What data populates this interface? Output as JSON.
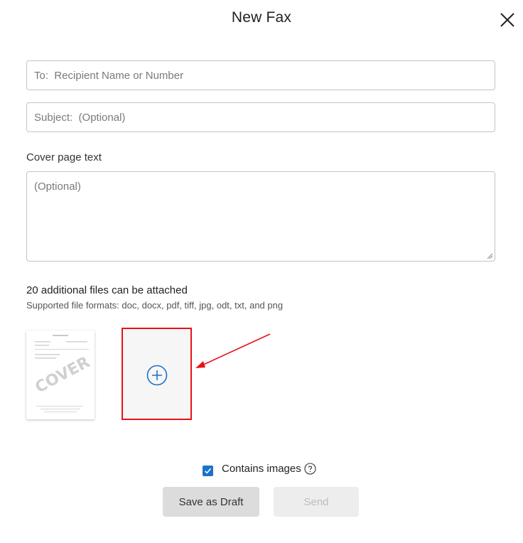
{
  "header": {
    "title": "New Fax"
  },
  "form": {
    "to_placeholder": "To:  Recipient Name or Number",
    "subject_placeholder": "Subject:  (Optional)",
    "cover_label": "Cover page text",
    "cover_placeholder": "(Optional)"
  },
  "attachments": {
    "title": "20 additional files can be attached",
    "formats": "Supported file formats: doc, docx, pdf, tiff, jpg, odt, txt, and png",
    "cover_thumb_text": "COVER"
  },
  "options": {
    "contains_images_label": "Contains images",
    "contains_images_checked": true
  },
  "actions": {
    "draft_label": "Save as Draft",
    "send_label": "Send"
  },
  "colors": {
    "accent": "#1a73c8",
    "annotation": "#e8111a"
  }
}
